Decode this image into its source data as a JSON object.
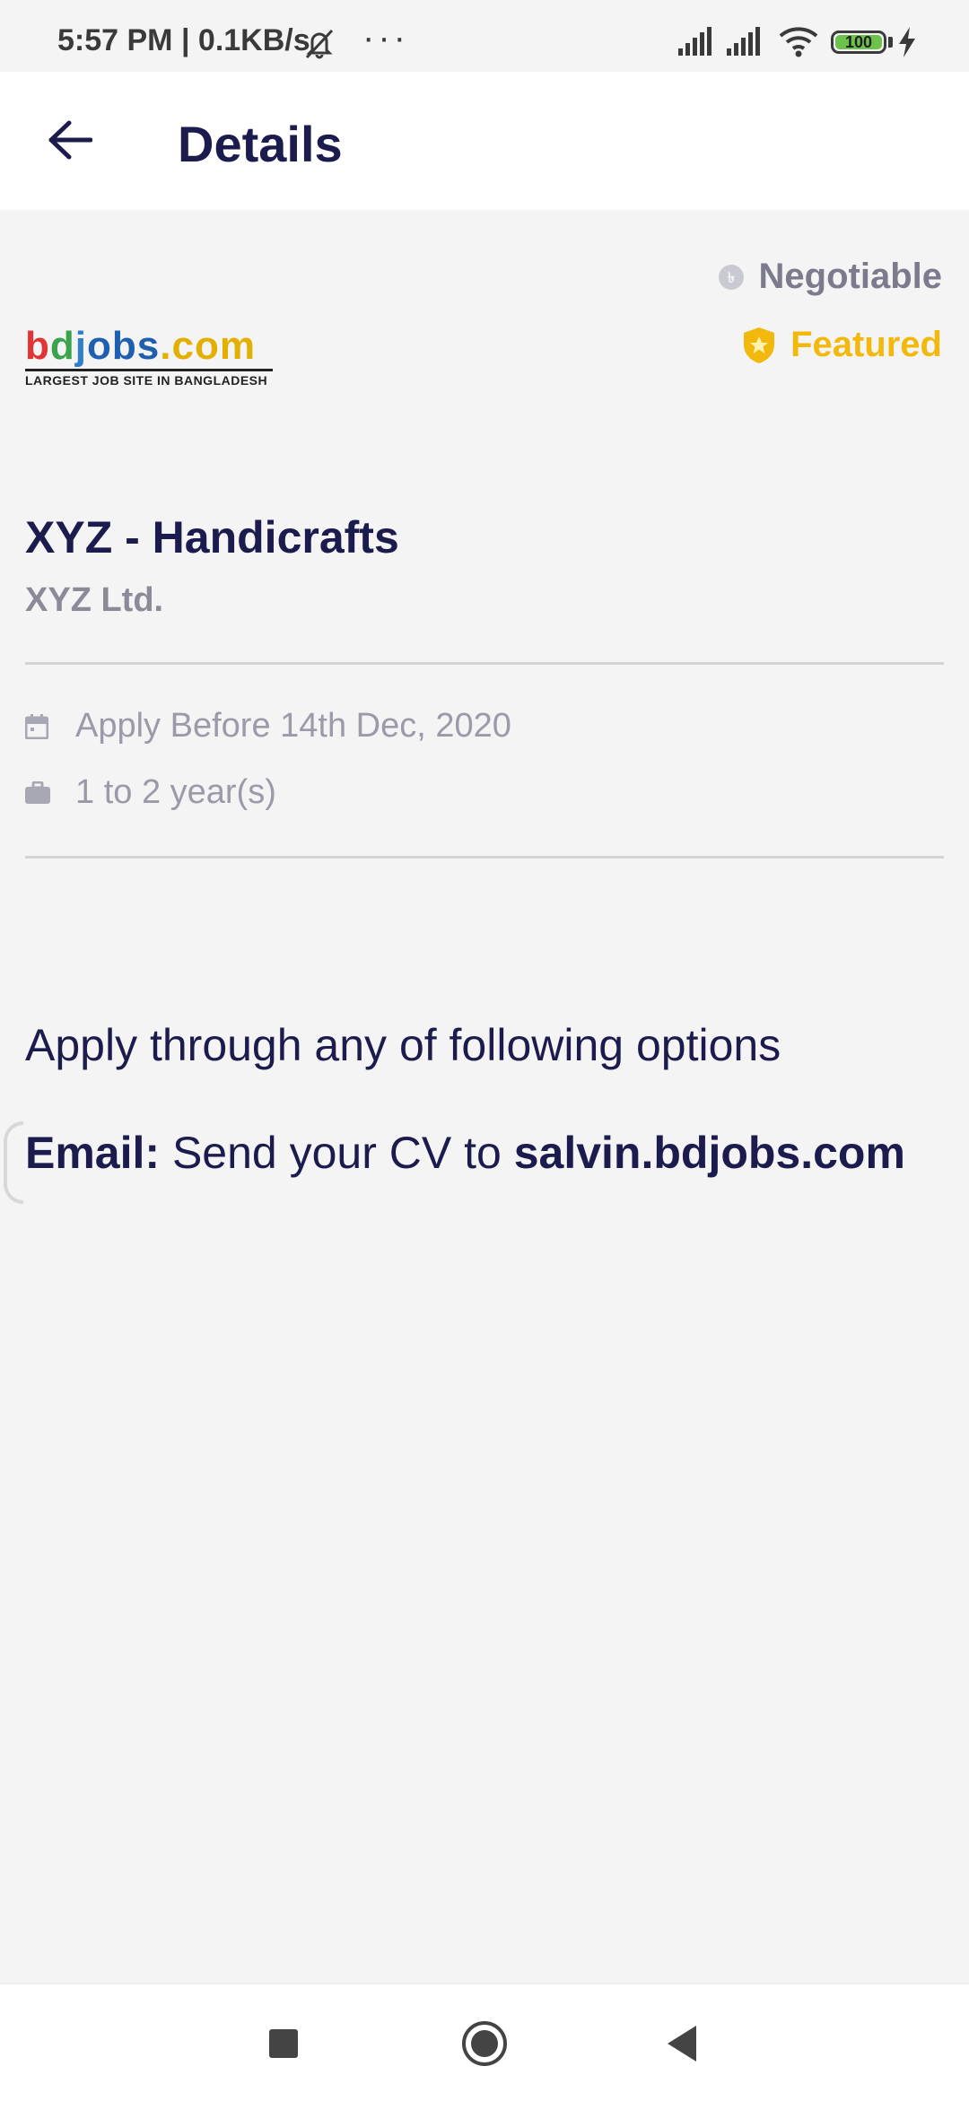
{
  "status_bar": {
    "time": "5:57 PM",
    "network_speed": "0.1KB/s",
    "battery": "100",
    "icons": [
      "mute-icon",
      "more-dots-icon",
      "signal-icon",
      "signal-icon",
      "wifi-icon",
      "battery-icon",
      "charging-icon"
    ]
  },
  "app_bar": {
    "title": "Details",
    "back_icon": "arrow-left-icon"
  },
  "badges": {
    "salary": "Negotiable",
    "featured": "Featured",
    "featured_color": "#f2b90c"
  },
  "logo": {
    "text_b": "b",
    "text_d": "d",
    "text_j": "j",
    "text_rest": "obs",
    "text_com": ".com",
    "tagline": "LARGEST JOB SITE IN BANGLADESH"
  },
  "job": {
    "title": "XYZ - Handicrafts",
    "company": "XYZ Ltd.",
    "deadline": "Apply Before 14th Dec, 2020",
    "experience": "1 to 2 year(s)"
  },
  "apply": {
    "heading": "Apply through any of following options",
    "email_label": "Email:",
    "email_text": " Send your CV to ",
    "email_address": "salvin.bdjobs.com"
  },
  "colors": {
    "primary": "#1c1b4d",
    "muted": "#8b8b98",
    "background": "#f4f4f4"
  }
}
